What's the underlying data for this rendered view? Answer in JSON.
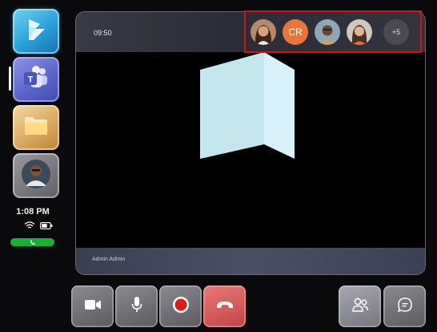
{
  "dock": {
    "apps": [
      {
        "name": "Dynamics 365 Guides",
        "icon": "dynamics-icon"
      },
      {
        "name": "Microsoft Teams",
        "icon": "teams-icon",
        "active": true
      },
      {
        "name": "Files",
        "icon": "folder-icon"
      },
      {
        "name": "Contact",
        "icon": "contact-avatar"
      }
    ],
    "clock": "1:08 PM",
    "status_icons": [
      "wifi-icon",
      "battery-icon"
    ],
    "call_indicator_color": "#13b33a"
  },
  "meeting": {
    "time": "09:50",
    "presenter": "Admin Admin",
    "participants": [
      {
        "type": "photo",
        "name": "participant-1"
      },
      {
        "type": "initials",
        "initials": "CR",
        "color": "#e8763c"
      },
      {
        "type": "photo",
        "name": "participant-3"
      },
      {
        "type": "photo",
        "name": "participant-4"
      }
    ],
    "more_count": "+5",
    "highlight_color": "#d01414"
  },
  "toolbar": {
    "buttons": [
      {
        "name": "camera",
        "icon": "camera-icon"
      },
      {
        "name": "microphone",
        "icon": "microphone-icon"
      },
      {
        "name": "record",
        "icon": "record-icon",
        "color": "#e01b1b"
      },
      {
        "name": "hang-up",
        "icon": "hang-up-icon",
        "color": "#c24444"
      },
      {
        "name": "participants",
        "icon": "people-icon"
      },
      {
        "name": "chat",
        "icon": "chat-icon"
      }
    ]
  }
}
